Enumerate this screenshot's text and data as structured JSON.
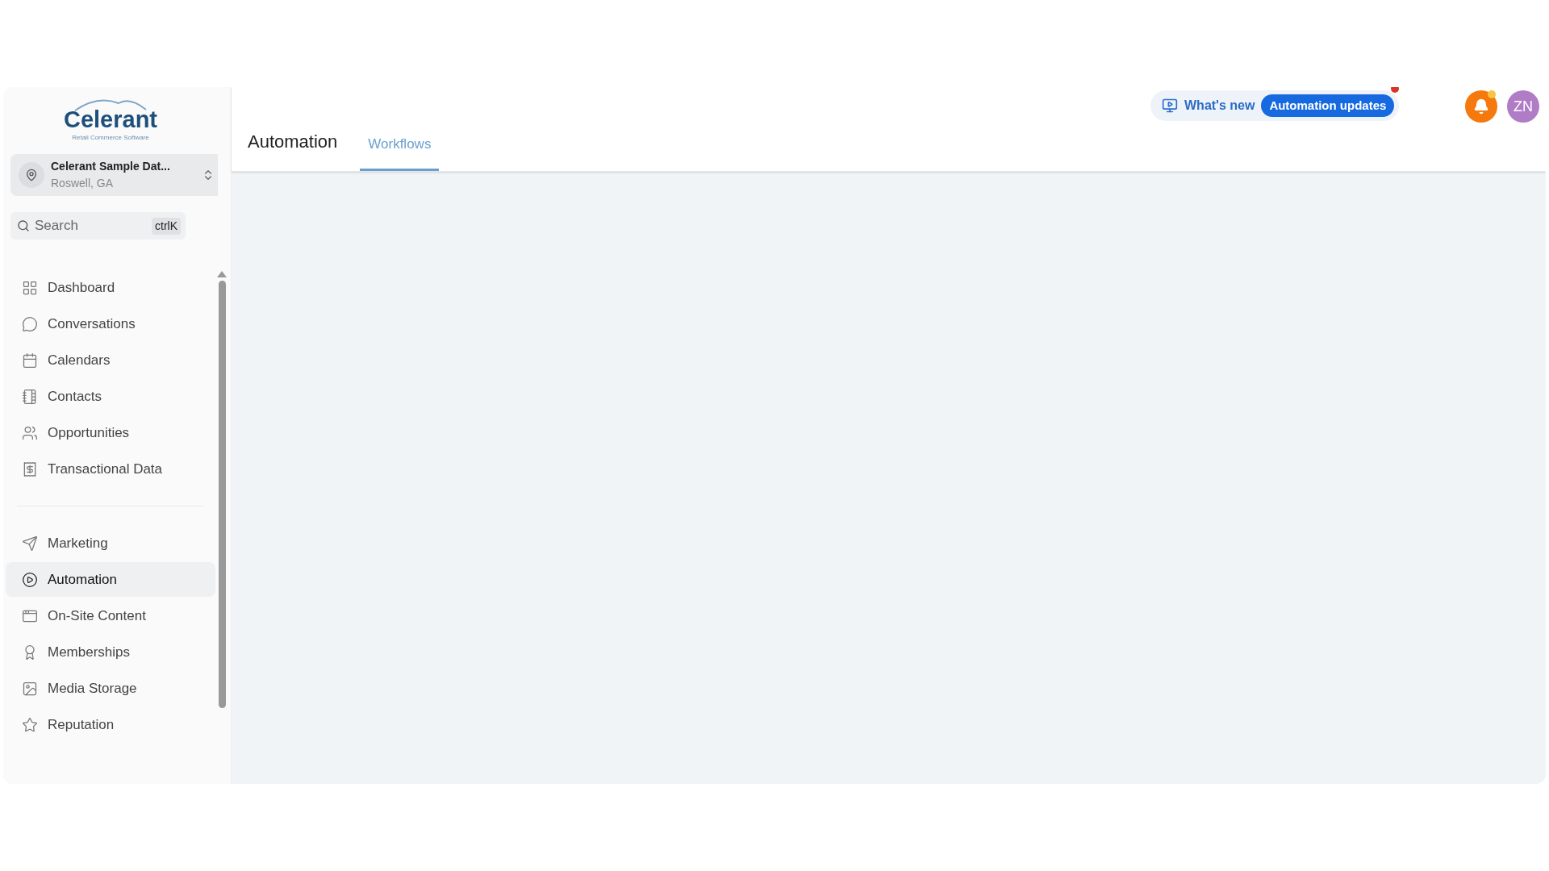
{
  "sidebar": {
    "logo": {
      "name": "Celerant",
      "tagline": "Retail Commerce Software"
    },
    "location": {
      "name": "Celerant Sample Dat...",
      "city": "Roswell, GA"
    },
    "search": {
      "placeholder": "Search",
      "shortcut": "ctrlK"
    },
    "groups": [
      [
        {
          "label": "Dashboard",
          "selected": false
        },
        {
          "label": "Conversations",
          "selected": false
        },
        {
          "label": "Calendars",
          "selected": false
        },
        {
          "label": "Contacts",
          "selected": false
        },
        {
          "label": "Opportunities",
          "selected": false
        },
        {
          "label": "Transactional Data",
          "selected": false
        }
      ],
      [
        {
          "label": "Marketing",
          "selected": false
        },
        {
          "label": "Automation",
          "selected": true
        },
        {
          "label": "On-Site Content",
          "selected": false
        },
        {
          "label": "Memberships",
          "selected": false
        },
        {
          "label": "Media Storage",
          "selected": false
        },
        {
          "label": "Reputation",
          "selected": false
        }
      ]
    ]
  },
  "header": {
    "title": "Automation",
    "tabs": [
      {
        "label": "Workflows",
        "selected": true
      }
    ],
    "whats_new": "What's new",
    "updates_badge": "Automation updates",
    "avatar": "ZN"
  }
}
